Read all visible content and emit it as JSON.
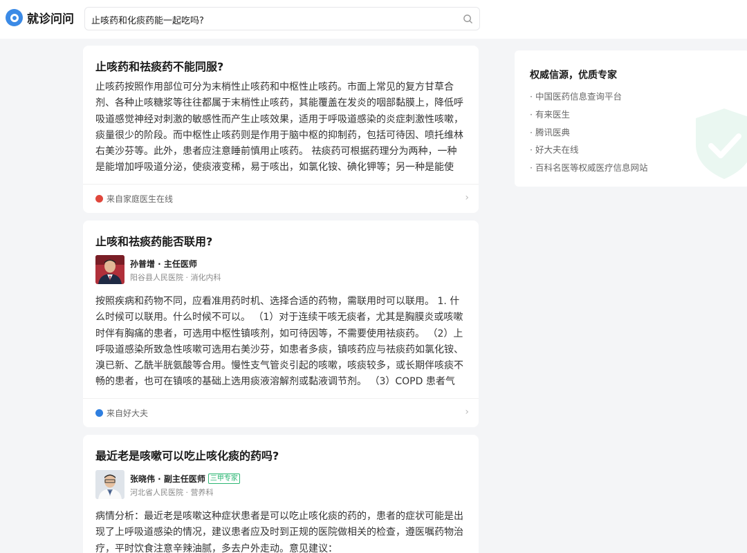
{
  "header": {
    "logo_text": "就诊问问",
    "search_value": "止咳药和化痰药能一起吃吗?"
  },
  "cards": [
    {
      "title": "止咳药和祛痰药不能同服?",
      "body": "止咳药按照作用部位可分为末梢性止咳药和中枢性止咳药。市面上常见的复方甘草合剂、各种止咳糖浆等往往都属于末梢性止咳药，其能覆盖在发炎的咽部黏膜上，降低呼吸道感觉神经对刺激的敏感性而产生止咳效果，适用于呼吸道感染的炎症刺激性咳嗽，痰量很少的阶段。而中枢性止咳药则是作用于脑中枢的抑制药，包括可待因、喷托维林右美沙芬等。此外，患者应注意睡前慎用止咳药。 祛痰药可根据药理分为两种，一种是能增加呼吸道分泌，使痰液变稀，易于咳出，如氯化铵、碘化钾等；另一种是能使痰...",
      "source": "来自家庭医生在线"
    },
    {
      "title": "止咳和祛痰药能否联用?",
      "doctor_name": "孙普增 · 主任医师",
      "doctor_hospital": "阳谷县人民医院 · 消化内科",
      "body": "按照疾病和药物不同，应看准用药时机、选择合适的药物，需联用时可以联用。 1. 什么时候可以联用。什么时候不可以。 （1）对于连续干咳无痰者，尤其是胸膜炎或咳嗽时伴有胸痛的患者，可选用中枢性镇咳剂，如可待因等，不需要使用祛痰药。 （2）上呼吸道感染所致急性咳嗽可选用右美沙芬，如患者多痰，镇咳药应与祛痰药如氯化铵、溴已新、乙酰半胱氨酸等合用。慢性支气管炎引起的咳嗽，咳痰较多，或长期伴咳痰不畅的患者，也可在镇咳的基础上选用痰液溶解剂或黏液调节剂。 （3）COPD 患者气道...",
      "source": "来自好大夫"
    },
    {
      "title": "最近老是咳嗽可以吃止咳化痰的药吗?",
      "doctor_name": "张晓伟 · 副主任医师",
      "doctor_tag": "三甲专家",
      "doctor_hospital": "河北省人民医院 · 营养科",
      "body": "病情分析：最近老是咳嗽这种症状患者是可以吃止咳化痰的药的，患者的症状可能是出现了上呼吸道感染的情况，建议患者应及时到正规的医院做相关的检查，遵医嘱药物治疗，平时饮食注意辛辣油腻，多去户外走动。意见建议："
    }
  ],
  "sidebar": {
    "title": "权威信源，优质专家",
    "items": [
      "· 中国医药信息查询平台",
      "· 有来医生",
      "· 腾讯医典",
      "· 好大夫在线",
      "· 百科名医等权威医疗信息网站"
    ]
  },
  "colors": {
    "brand": "#3b8ae6",
    "accent_green": "#2bb673",
    "source_red": "#e0473c",
    "source_blue": "#2f7fe0"
  }
}
